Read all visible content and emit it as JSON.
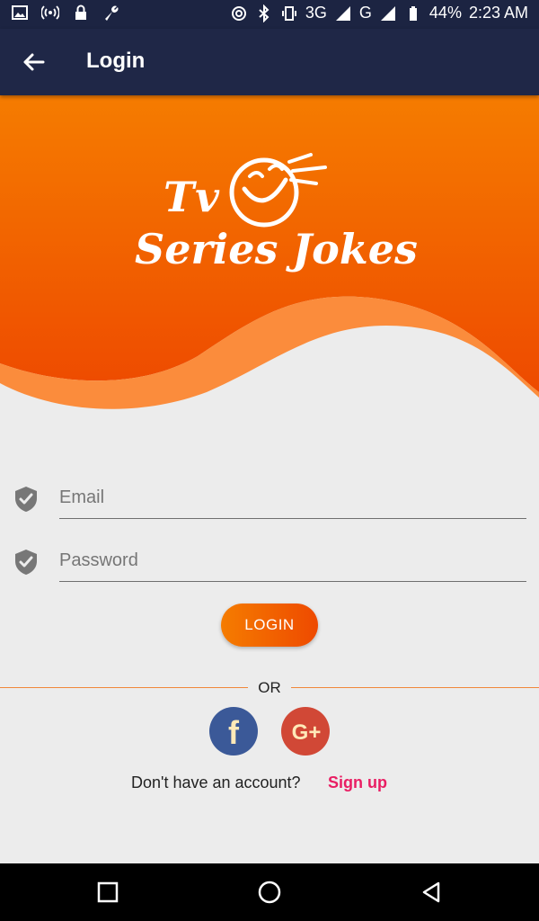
{
  "status_bar": {
    "icons_left": [
      "image-icon",
      "hotspot-icon",
      "lock-icon",
      "wrench-icon"
    ],
    "icons_right": [
      "nfc-icon",
      "bluetooth-icon",
      "vibrate-icon"
    ],
    "network_1": "3G",
    "network_2": "G",
    "battery": "44%",
    "time": "2:23 AM"
  },
  "app_bar": {
    "title": "Login"
  },
  "hero": {
    "logo_line1": "Tv",
    "logo_line2": "Series Jokes",
    "colors": {
      "top": "#f57c00",
      "bottom": "#ee4a00",
      "wave_light": "#fb8c3c"
    }
  },
  "form": {
    "email_placeholder": "Email",
    "password_placeholder": "Password",
    "login_label": "LOGIN"
  },
  "social": {
    "or_label": "OR",
    "facebook_glyph": "f",
    "google_glyph": "G+"
  },
  "signup": {
    "question": "Don't have an account?",
    "link": "Sign up"
  },
  "colors": {
    "appbar": "#1f2747",
    "accent": "#e91e63",
    "background": "#ececec"
  }
}
